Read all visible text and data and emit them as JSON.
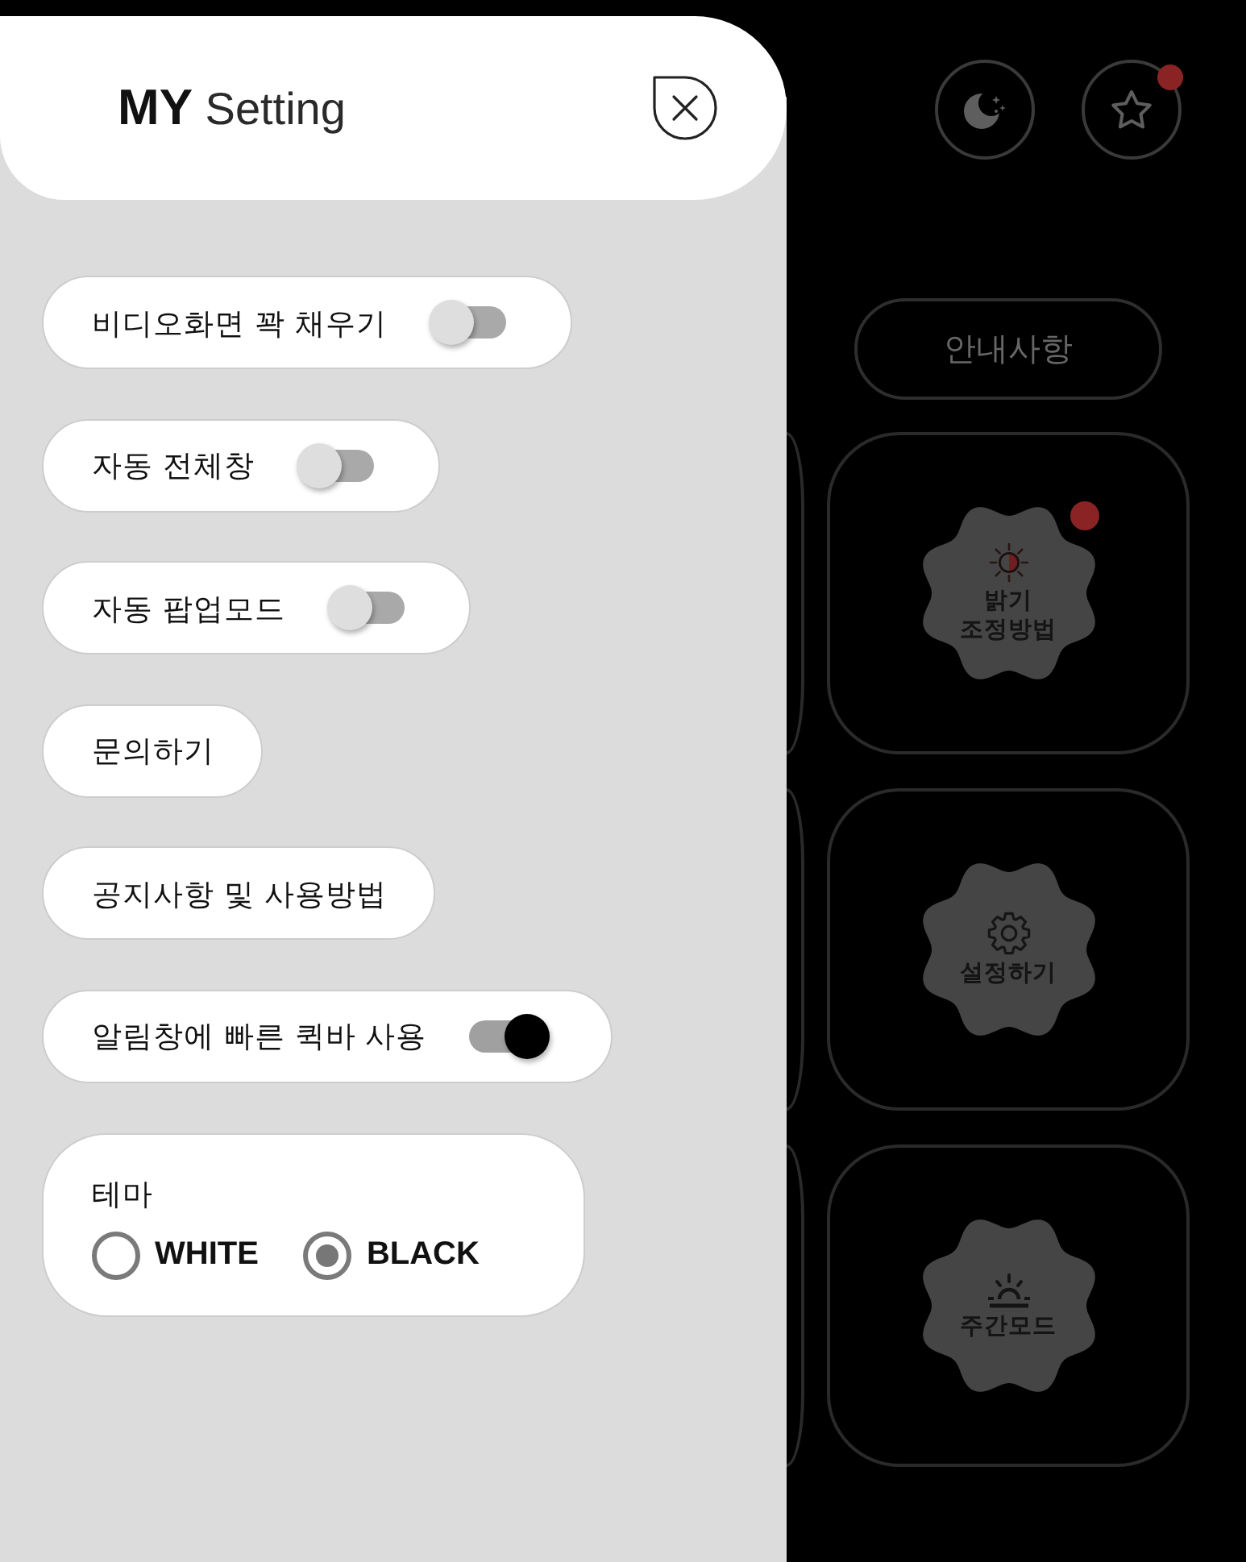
{
  "settings_panel": {
    "title": "**MY** Setting",
    "options": [
      {
        "kind": "toggle",
        "label": "비디오화면 꽉 채우기",
        "on": false
      },
      {
        "kind": "toggle",
        "label": "자동 전체창",
        "on": false
      },
      {
        "kind": "toggle",
        "label": "자동 팝업모드",
        "on": false
      },
      {
        "kind": "link",
        "label": "문의하기"
      },
      {
        "kind": "link",
        "label": "공지사항 및 사용방법"
      },
      {
        "kind": "toggle",
        "label": "알림창에 빠른 퀵바 사용",
        "on": true
      }
    ],
    "theme": {
      "label": "테마",
      "options": [
        {
          "label": "WHITE",
          "selected": false
        },
        {
          "label": "BLACK",
          "selected": true
        }
      ]
    }
  },
  "background_screen": {
    "top_buttons": [
      {
        "kind": "moon",
        "badge": false
      },
      {
        "kind": "star",
        "badge": true
      }
    ],
    "notice_button": "안내사항",
    "tiles": [
      {
        "kind": "brightness",
        "label": "밝기\n조정방법",
        "badge": true
      },
      {
        "kind": "settings",
        "label": "설정하기",
        "badge": false
      },
      {
        "kind": "daytime",
        "label": "주간모드",
        "badge": false
      }
    ]
  }
}
